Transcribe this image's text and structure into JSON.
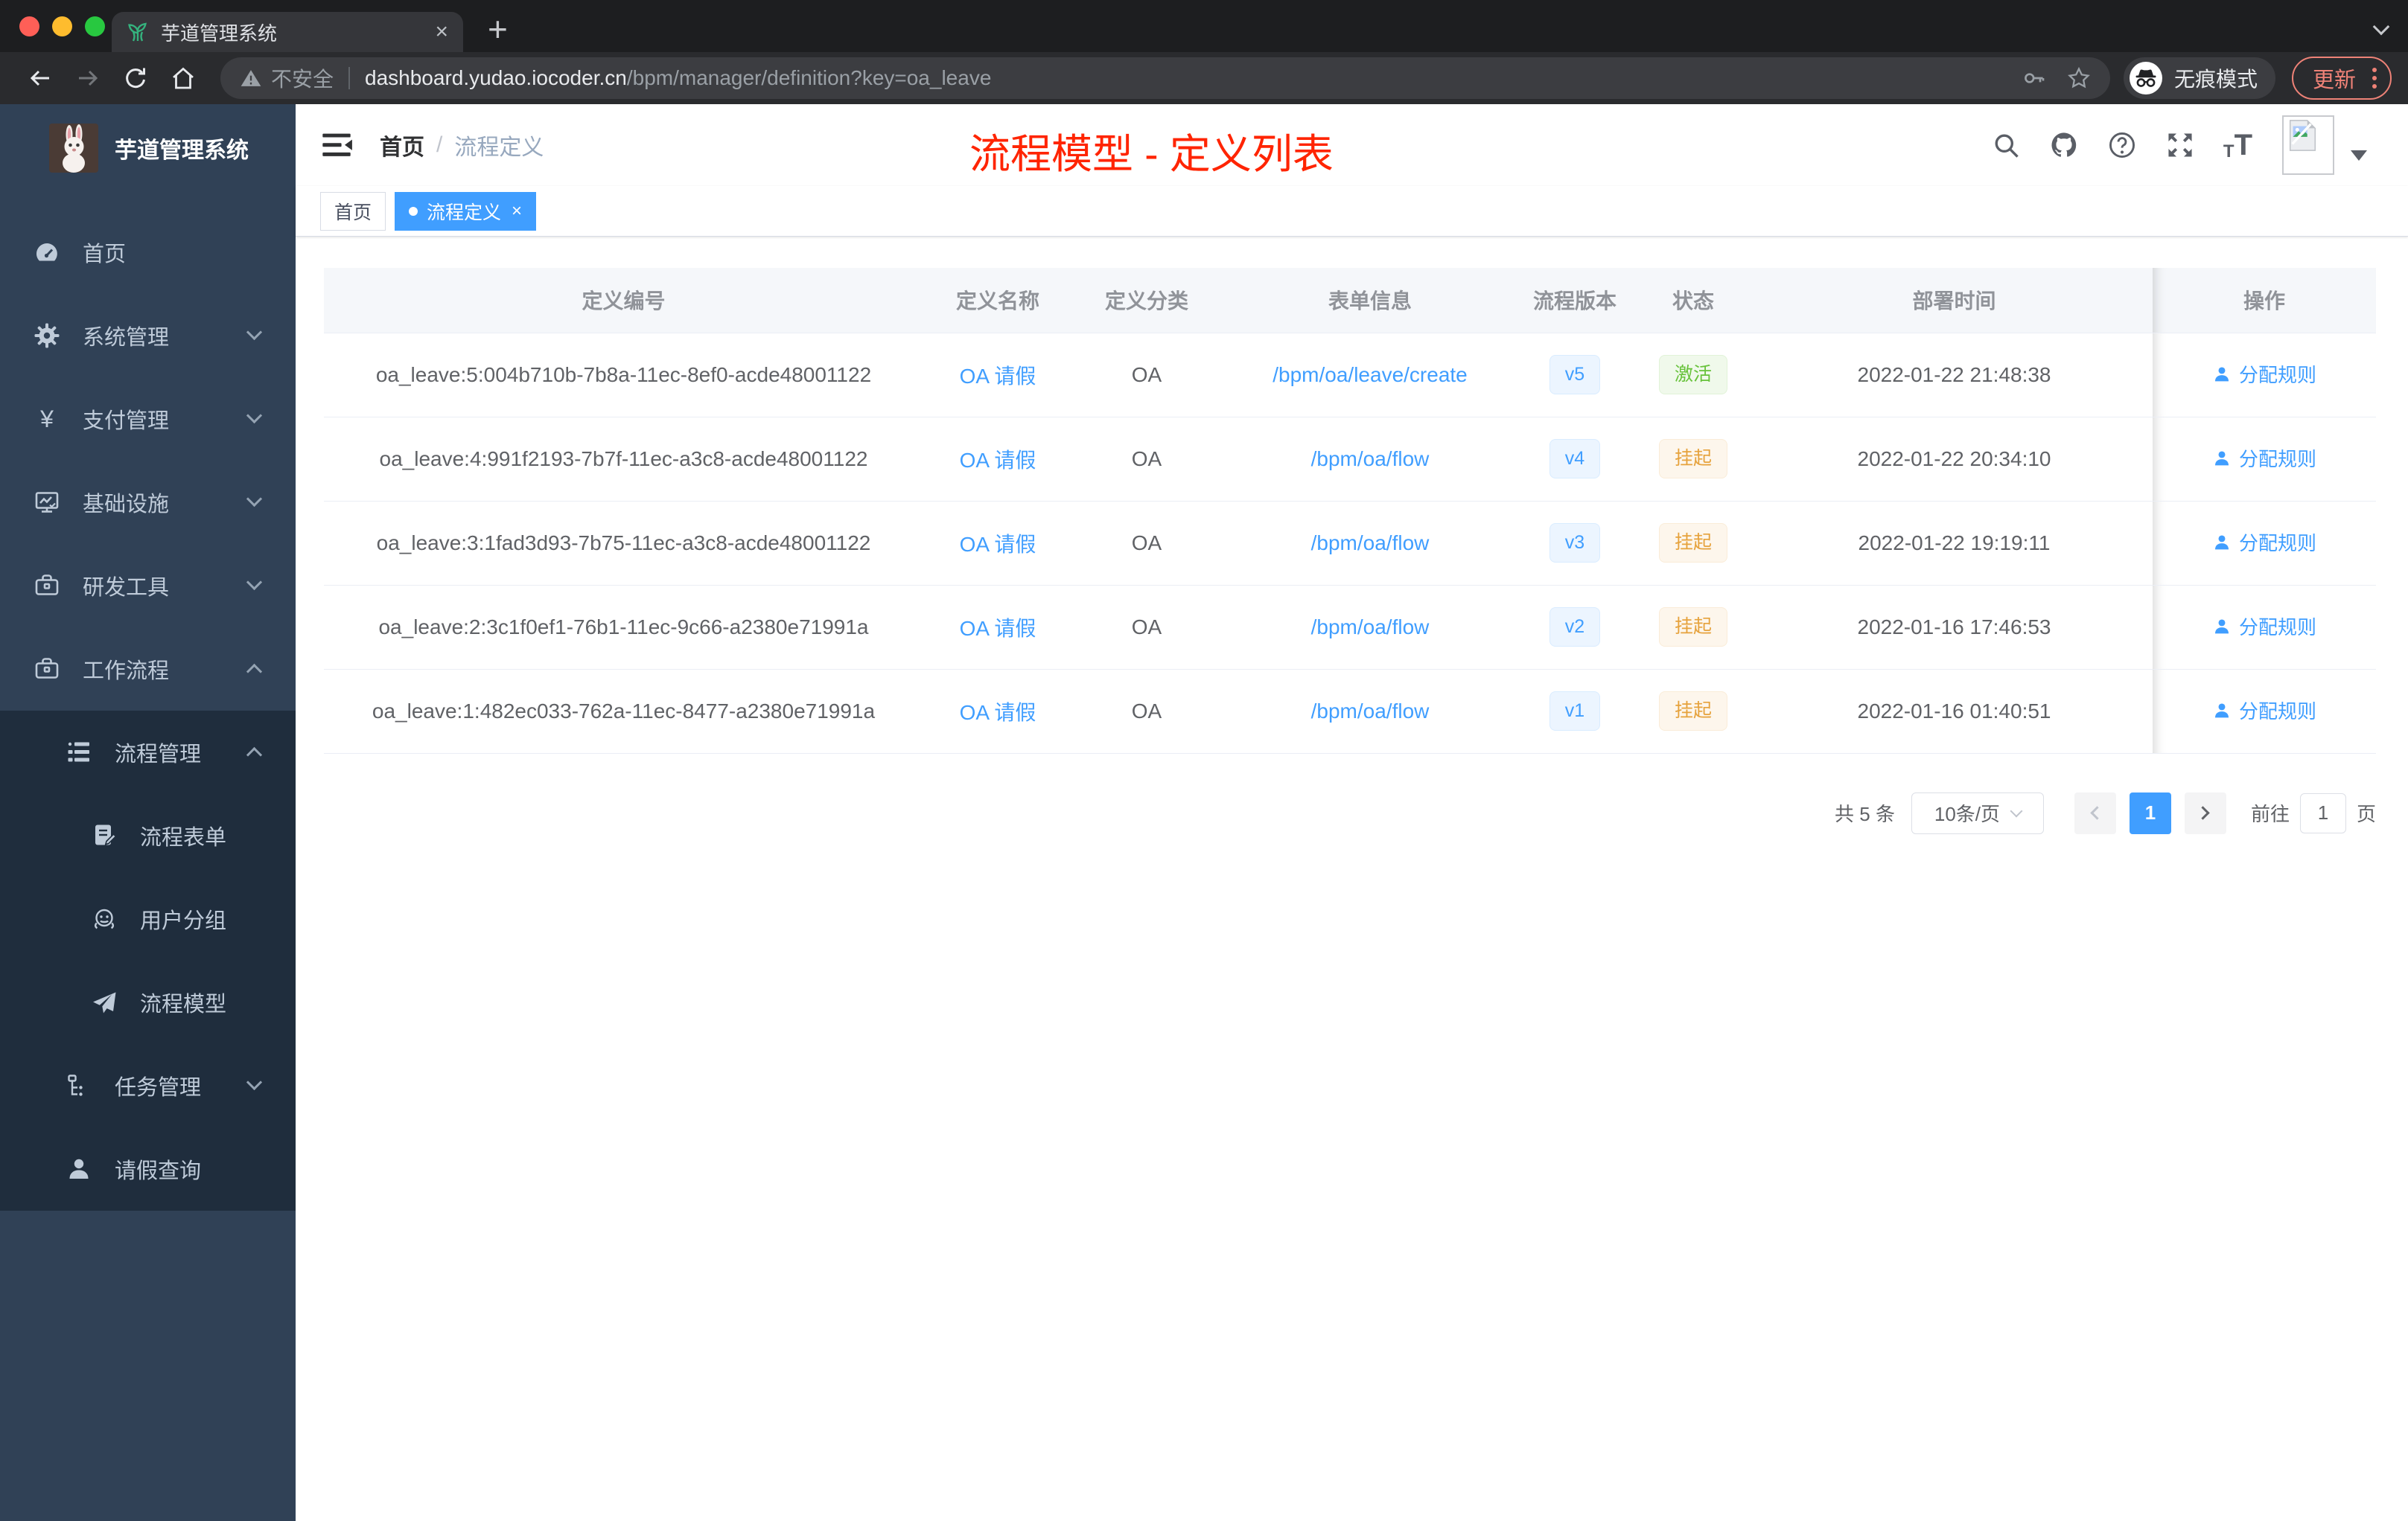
{
  "browser": {
    "tab_title": "芋道管理系统",
    "security_label": "不安全",
    "url_host": "dashboard.yudao.iocoder.cn",
    "url_path": "/bpm/manager/definition?key=oa_leave",
    "incognito_label": "无痕模式",
    "update_label": "更新"
  },
  "sidebar": {
    "logo_title": "芋道管理系统",
    "menu": [
      {
        "key": "home",
        "icon": "dashboard-icon",
        "label": "首页",
        "level": 1,
        "arrow": null,
        "dark": false
      },
      {
        "key": "system",
        "icon": "gear-icon",
        "label": "系统管理",
        "level": 1,
        "arrow": "down",
        "dark": false
      },
      {
        "key": "payment",
        "icon": "yen-icon",
        "label": "支付管理",
        "level": 1,
        "arrow": "down",
        "dark": false
      },
      {
        "key": "infra",
        "icon": "monitor-icon",
        "label": "基础设施",
        "level": 1,
        "arrow": "down",
        "dark": false
      },
      {
        "key": "devtools",
        "icon": "toolbox-icon",
        "label": "研发工具",
        "level": 1,
        "arrow": "down",
        "dark": false
      },
      {
        "key": "workflow",
        "icon": "briefcase-icon",
        "label": "工作流程",
        "level": 1,
        "arrow": "up",
        "dark": false
      },
      {
        "key": "process-mgmt",
        "icon": "tree-table-icon",
        "label": "流程管理",
        "level": 2,
        "arrow": "up",
        "dark": true
      },
      {
        "key": "process-form",
        "icon": "form-icon",
        "label": "流程表单",
        "level": 3,
        "arrow": null,
        "dark": true
      },
      {
        "key": "user-group",
        "icon": "people-icon",
        "label": "用户分组",
        "level": 3,
        "arrow": null,
        "dark": true
      },
      {
        "key": "process-model",
        "icon": "paper-plane-icon",
        "label": "流程模型",
        "level": 3,
        "arrow": null,
        "dark": true
      },
      {
        "key": "task-mgmt",
        "icon": "org-tree-icon",
        "label": "任务管理",
        "level": 2,
        "arrow": "down",
        "dark": true
      },
      {
        "key": "leave-query",
        "icon": "user-icon",
        "label": "请假查询",
        "level": 2,
        "arrow": null,
        "dark": true
      }
    ]
  },
  "navbar": {
    "breadcrumb_home": "首页",
    "breadcrumb_separator": "/",
    "breadcrumb_current": "流程定义",
    "annotation": "流程模型 - 定义列表"
  },
  "tags": [
    {
      "label": "首页",
      "active": false,
      "closable": false
    },
    {
      "label": "流程定义",
      "active": true,
      "closable": true
    }
  ],
  "table": {
    "columns": [
      "定义编号",
      "定义名称",
      "定义分类",
      "表单信息",
      "流程版本",
      "状态",
      "部署时间",
      "操作"
    ],
    "action_label": "分配规则",
    "rows": [
      {
        "id": "oa_leave:5:004b710b-7b8a-11ec-8ef0-acde48001122",
        "name": "OA 请假",
        "category": "OA",
        "form": "/bpm/oa/leave/create",
        "version": "v5",
        "status": "激活",
        "status_type": "success",
        "deployed": "2022-01-22 21:48:38"
      },
      {
        "id": "oa_leave:4:991f2193-7b7f-11ec-a3c8-acde48001122",
        "name": "OA 请假",
        "category": "OA",
        "form": "/bpm/oa/flow",
        "version": "v4",
        "status": "挂起",
        "status_type": "warning",
        "deployed": "2022-01-22 20:34:10"
      },
      {
        "id": "oa_leave:3:1fad3d93-7b75-11ec-a3c8-acde48001122",
        "name": "OA 请假",
        "category": "OA",
        "form": "/bpm/oa/flow",
        "version": "v3",
        "status": "挂起",
        "status_type": "warning",
        "deployed": "2022-01-22 19:19:11"
      },
      {
        "id": "oa_leave:2:3c1f0ef1-76b1-11ec-9c66-a2380e71991a",
        "name": "OA 请假",
        "category": "OA",
        "form": "/bpm/oa/flow",
        "version": "v2",
        "status": "挂起",
        "status_type": "warning",
        "deployed": "2022-01-16 17:46:53"
      },
      {
        "id": "oa_leave:1:482ec033-762a-11ec-8477-a2380e71991a",
        "name": "OA 请假",
        "category": "OA",
        "form": "/bpm/oa/flow",
        "version": "v1",
        "status": "挂起",
        "status_type": "warning",
        "deployed": "2022-01-16 01:40:51"
      }
    ]
  },
  "pagination": {
    "total_label": "共 5 条",
    "page_size": "10条/页",
    "current_page": "1",
    "goto_label": "前往",
    "goto_value": "1",
    "page_unit": "页"
  },
  "colors": {
    "accent": "#409eff",
    "success": "#67c23a",
    "warning": "#e6a23c",
    "annotation": "#ff2400",
    "sidebar_bg": "#304156",
    "submenu_bg": "#1f2d3d"
  }
}
